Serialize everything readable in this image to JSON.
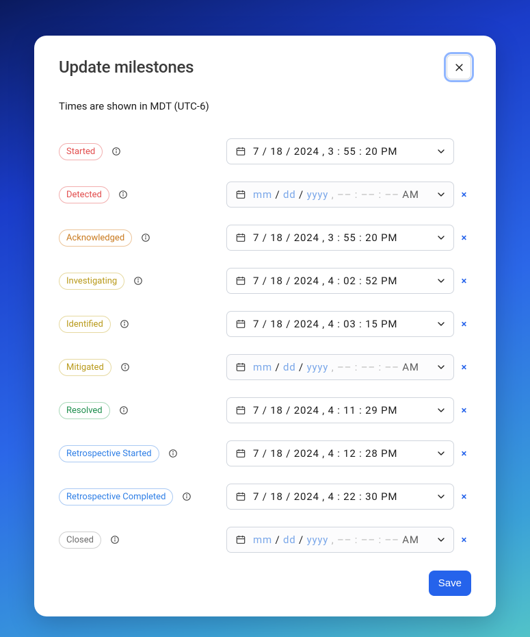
{
  "title": "Update milestones",
  "subtitle": "Times are shown in MDT (UTC-6)",
  "save_label": "Save",
  "placeholder": {
    "mm": "mm",
    "dd": "dd",
    "yyyy": "yyyy",
    "time": "–– : –– : ––",
    "ampm": "AM"
  },
  "colors": {
    "red": {
      "text": "#e24d4d",
      "border": "#f2aeae"
    },
    "orange": {
      "text": "#c97a1f",
      "border": "#ecc499"
    },
    "yellow": {
      "text": "#b99a1b",
      "border": "#e6d9a0"
    },
    "green": {
      "text": "#1f8f4e",
      "border": "#a9d9b9"
    },
    "blue": {
      "text": "#2f7fe6",
      "border": "#a9c9f3"
    },
    "gray": {
      "text": "#6b6b6b",
      "border": "#cfcfcf"
    }
  },
  "milestones": [
    {
      "key": "started",
      "label": "Started",
      "color": "red",
      "value": "7 / 18 / 2024 ,   3 : 55 : 20  PM",
      "clearable": false
    },
    {
      "key": "detected",
      "label": "Detected",
      "color": "red",
      "value": null,
      "clearable": true
    },
    {
      "key": "acknowledged",
      "label": "Acknowledged",
      "color": "orange",
      "value": "7 / 18 / 2024 ,   3 : 55 : 20  PM",
      "clearable": true
    },
    {
      "key": "investigating",
      "label": "Investigating",
      "color": "yellow",
      "value": "7 / 18 / 2024 ,   4 : 02 : 52  PM",
      "clearable": true
    },
    {
      "key": "identified",
      "label": "Identified",
      "color": "yellow",
      "value": "7 / 18 / 2024 ,   4 : 03 : 15  PM",
      "clearable": true
    },
    {
      "key": "mitigated",
      "label": "Mitigated",
      "color": "yellow",
      "value": null,
      "clearable": true
    },
    {
      "key": "resolved",
      "label": "Resolved",
      "color": "green",
      "value": "7 / 18 / 2024 ,   4 : 11 : 29  PM",
      "clearable": true
    },
    {
      "key": "retro-started",
      "label": "Retrospective Started",
      "color": "blue",
      "value": "7 / 18 / 2024 ,   4 : 12 : 28  PM",
      "clearable": true
    },
    {
      "key": "retro-completed",
      "label": "Retrospective Completed",
      "color": "blue",
      "value": "7 / 18 / 2024 ,   4 : 22 : 30  PM",
      "clearable": true
    },
    {
      "key": "closed",
      "label": "Closed",
      "color": "gray",
      "value": null,
      "clearable": true
    }
  ]
}
